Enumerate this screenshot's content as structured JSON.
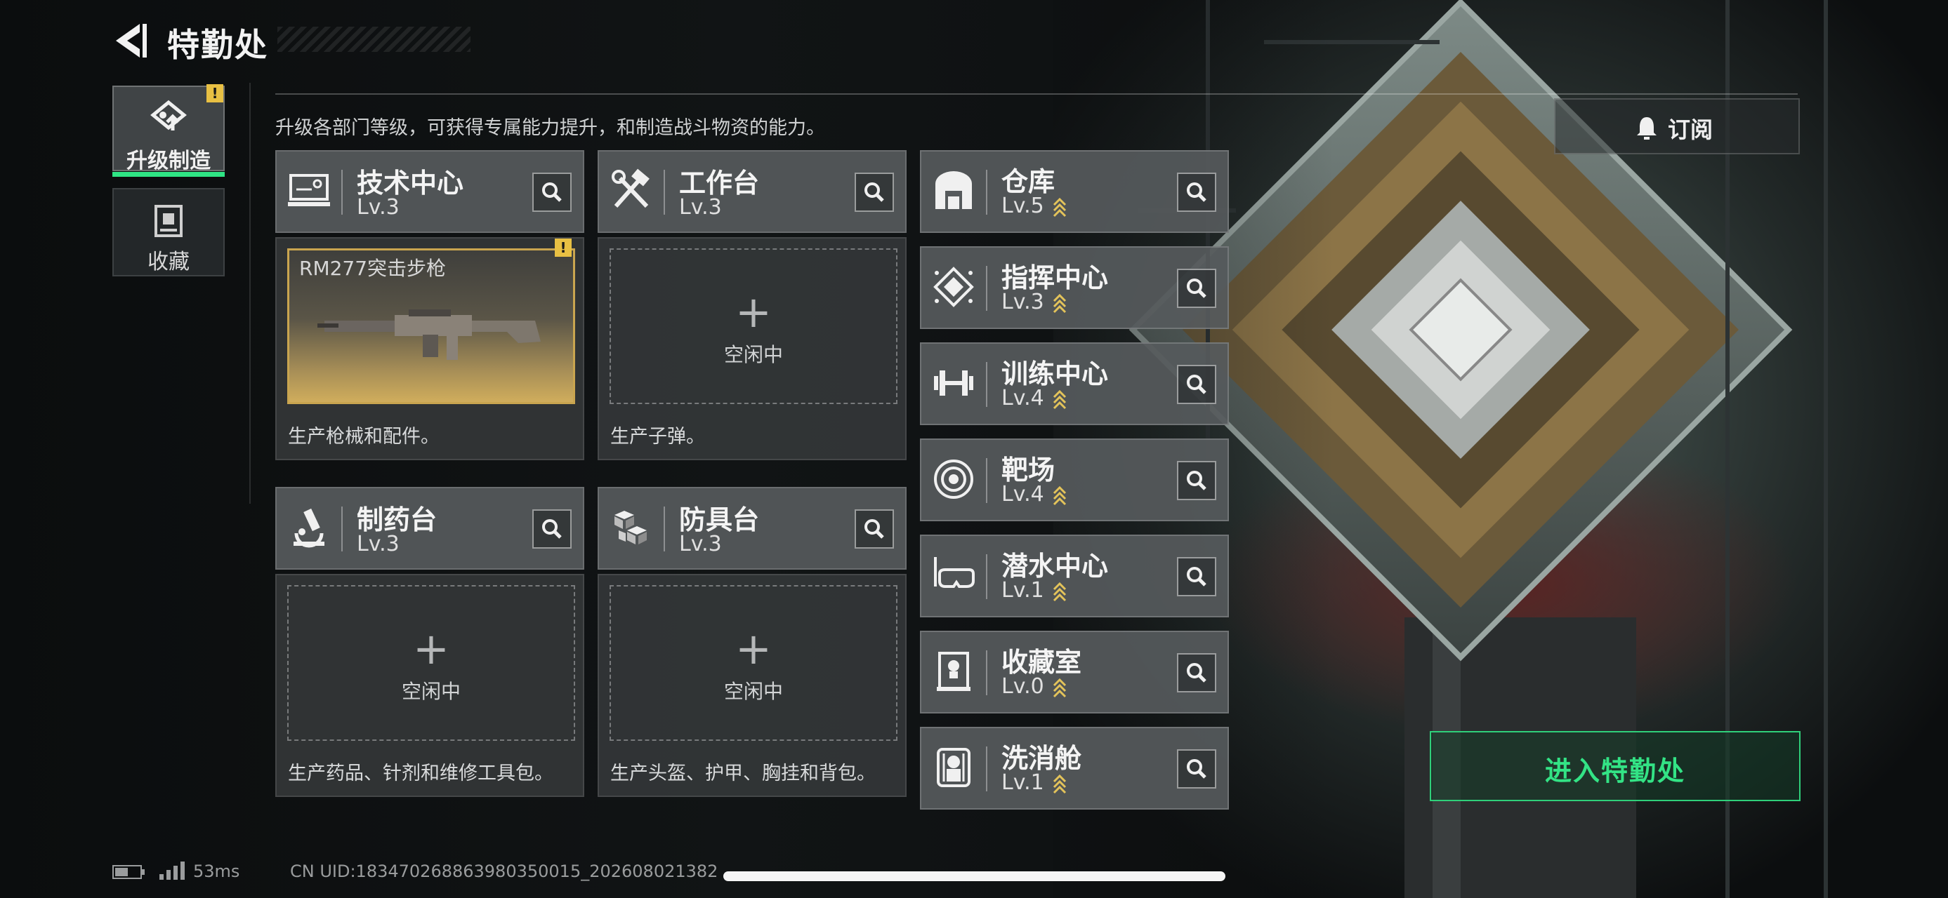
{
  "header": {
    "title": "特勤处"
  },
  "sidebar": {
    "tabs": [
      {
        "label": "升级制造",
        "active": true,
        "badge": "!"
      },
      {
        "label": "收藏",
        "active": false
      }
    ]
  },
  "subtitle": "升级各部门等级，可获得专属能力提升，和制造战斗物资的能力。",
  "subscribe": {
    "label": "订阅"
  },
  "stations": [
    {
      "name": "技术中心",
      "level": "Lv.3",
      "icon": "monitor-icon",
      "item": {
        "name": "RM277突击步枪",
        "badge": "!"
      },
      "desc": "生产枪械和配件。"
    },
    {
      "name": "工作台",
      "level": "Lv.3",
      "icon": "tools-icon",
      "idle": "空闲中",
      "plus": "+",
      "desc": "生产子弹。"
    },
    {
      "name": "制药台",
      "level": "Lv.3",
      "icon": "microscope-icon",
      "idle": "空闲中",
      "plus": "+",
      "desc": "生产药品、针剂和维修工具包。"
    },
    {
      "name": "防具台",
      "level": "Lv.3",
      "icon": "cubes-icon",
      "idle": "空闲中",
      "plus": "+",
      "desc": "生产头盔、护甲、胸挂和背包。"
    }
  ],
  "facilities": [
    {
      "name": "仓库",
      "level": "Lv.5",
      "icon": "warehouse-icon"
    },
    {
      "name": "指挥中心",
      "level": "Lv.3",
      "icon": "command-icon"
    },
    {
      "name": "训练中心",
      "level": "Lv.4",
      "icon": "dumbbell-icon"
    },
    {
      "name": "靶场",
      "level": "Lv.4",
      "icon": "target-icon"
    },
    {
      "name": "潜水中心",
      "level": "Lv.1",
      "icon": "diving-mask-icon"
    },
    {
      "name": "收藏室",
      "level": "Lv.0",
      "icon": "display-case-icon"
    },
    {
      "name": "洗消舱",
      "level": "Lv.1",
      "icon": "hazmat-icon"
    }
  ],
  "enter": {
    "label": "进入特勤处"
  },
  "status": {
    "latency": "53ms",
    "uid": "CN UID:18347026886398035001​5_202608021382"
  },
  "colors": {
    "accent": "#2fe585",
    "warning": "#e8c043",
    "gold": "#c9a54f"
  }
}
